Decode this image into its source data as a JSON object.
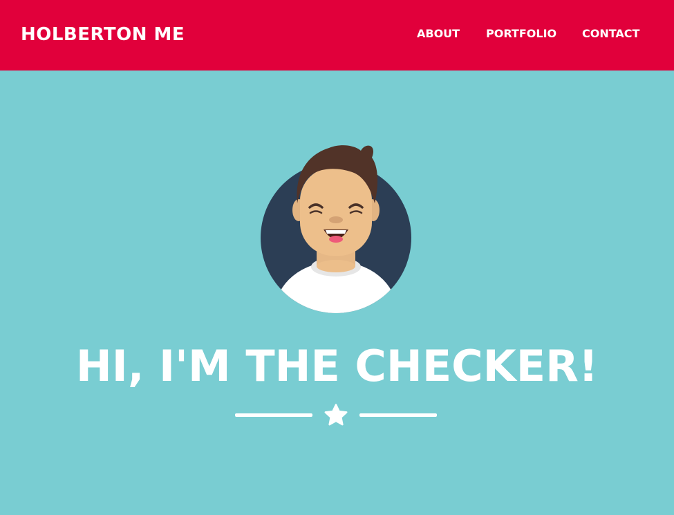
{
  "navbar": {
    "brand": "HOLBERTON ME",
    "links": [
      {
        "label": "ABOUT"
      },
      {
        "label": "PORTFOLIO"
      },
      {
        "label": "CONTACT"
      }
    ],
    "background_color": "#e1003b"
  },
  "hero": {
    "background_color": "#79cdd2",
    "avatar_icon": "smiling-person-avatar",
    "heading": "HI, I'M THE CHECKER!",
    "divider_icon": "star-icon"
  }
}
